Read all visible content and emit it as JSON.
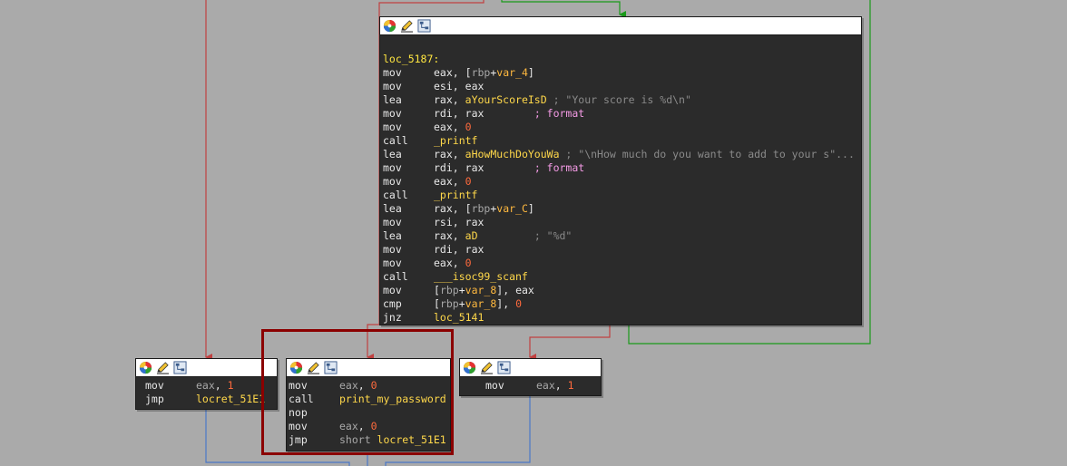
{
  "colors": {
    "background": "#aaaaaa",
    "block_bg": "#2b2b2b",
    "edge_red": "#c04040",
    "edge_green": "#1a9a1a",
    "edge_blue": "#4a78c8",
    "selection": "#8b0000"
  },
  "icons": [
    "graph-color-icon",
    "rename-pencil-icon",
    "graph-overview-icon"
  ],
  "main_block": {
    "label": "loc_5187:",
    "lines": [
      {
        "mn": "mov",
        "ops": [
          [
            "eax",
            "n"
          ],
          [
            ", [",
            "n"
          ],
          [
            "rbp",
            "reg"
          ],
          [
            "+",
            "n"
          ],
          [
            "var_4",
            "var"
          ],
          [
            "]",
            "n"
          ]
        ]
      },
      {
        "mn": "mov",
        "ops": [
          [
            "esi",
            "n"
          ],
          [
            ", ",
            "n"
          ],
          [
            "eax",
            "n"
          ]
        ]
      },
      {
        "mn": "lea",
        "ops": [
          [
            "rax",
            "n"
          ],
          [
            ", ",
            "n"
          ],
          [
            "aYourScoreIsD",
            "name"
          ],
          [
            " ; \"Your score is %d\\n\"",
            "cmt"
          ]
        ]
      },
      {
        "mn": "mov",
        "ops": [
          [
            "rdi",
            "n"
          ],
          [
            ", ",
            "n"
          ],
          [
            "rax",
            "n"
          ],
          [
            "        ",
            "n"
          ],
          [
            "; format",
            "fmt"
          ]
        ]
      },
      {
        "mn": "mov",
        "ops": [
          [
            "eax",
            "n"
          ],
          [
            ", ",
            "n"
          ],
          [
            "0",
            "num"
          ]
        ]
      },
      {
        "mn": "call",
        "ops": [
          [
            "_printf",
            "name"
          ]
        ]
      },
      {
        "mn": "lea",
        "ops": [
          [
            "rax",
            "n"
          ],
          [
            ", ",
            "n"
          ],
          [
            "aHowMuchDoYouWa",
            "name"
          ],
          [
            " ; \"\\nHow much do you want to add to your s\"...",
            "cmt"
          ]
        ]
      },
      {
        "mn": "mov",
        "ops": [
          [
            "rdi",
            "n"
          ],
          [
            ", ",
            "n"
          ],
          [
            "rax",
            "n"
          ],
          [
            "        ",
            "n"
          ],
          [
            "; format",
            "fmt"
          ]
        ]
      },
      {
        "mn": "mov",
        "ops": [
          [
            "eax",
            "n"
          ],
          [
            ", ",
            "n"
          ],
          [
            "0",
            "num"
          ]
        ]
      },
      {
        "mn": "call",
        "ops": [
          [
            "_printf",
            "name"
          ]
        ]
      },
      {
        "mn": "lea",
        "ops": [
          [
            "rax",
            "n"
          ],
          [
            ", [",
            "n"
          ],
          [
            "rbp",
            "reg"
          ],
          [
            "+",
            "n"
          ],
          [
            "var_C",
            "var"
          ],
          [
            "]",
            "n"
          ]
        ]
      },
      {
        "mn": "mov",
        "ops": [
          [
            "rsi",
            "n"
          ],
          [
            ", ",
            "n"
          ],
          [
            "rax",
            "n"
          ]
        ]
      },
      {
        "mn": "lea",
        "ops": [
          [
            "rax",
            "n"
          ],
          [
            ", ",
            "n"
          ],
          [
            "aD",
            "name"
          ],
          [
            "         ",
            "n"
          ],
          [
            "; \"%d\"",
            "cmt"
          ]
        ]
      },
      {
        "mn": "mov",
        "ops": [
          [
            "rdi",
            "n"
          ],
          [
            ", ",
            "n"
          ],
          [
            "rax",
            "n"
          ]
        ]
      },
      {
        "mn": "mov",
        "ops": [
          [
            "eax",
            "n"
          ],
          [
            ", ",
            "n"
          ],
          [
            "0",
            "num"
          ]
        ]
      },
      {
        "mn": "call",
        "ops": [
          [
            "___isoc99_scanf",
            "name"
          ]
        ]
      },
      {
        "mn": "mov",
        "ops": [
          [
            "[",
            "n"
          ],
          [
            "rbp",
            "reg"
          ],
          [
            "+",
            "n"
          ],
          [
            "var_8",
            "var"
          ],
          [
            "], ",
            "n"
          ],
          [
            "eax",
            "n"
          ]
        ]
      },
      {
        "mn": "cmp",
        "ops": [
          [
            "[",
            "n"
          ],
          [
            "rbp",
            "reg"
          ],
          [
            "+",
            "n"
          ],
          [
            "var_8",
            "var"
          ],
          [
            "], ",
            "n"
          ],
          [
            "0",
            "num"
          ]
        ]
      },
      {
        "mn": "jnz",
        "ops": [
          [
            "loc_5141",
            "name"
          ]
        ]
      }
    ]
  },
  "left_block": {
    "lines": [
      {
        "mn": "mov",
        "ops": [
          [
            "eax",
            "reg"
          ],
          [
            ", ",
            "n"
          ],
          [
            "1",
            "num"
          ]
        ]
      },
      {
        "mn": "jmp",
        "ops": [
          [
            "locret_51E1",
            "name"
          ]
        ]
      }
    ]
  },
  "middle_block": {
    "lines": [
      {
        "mn": "mov",
        "ops": [
          [
            "eax",
            "reg"
          ],
          [
            ", ",
            "n"
          ],
          [
            "0",
            "num"
          ]
        ]
      },
      {
        "mn": "call",
        "ops": [
          [
            "print_my_password",
            "name"
          ]
        ]
      },
      {
        "mn": "nop",
        "ops": []
      },
      {
        "mn": "mov",
        "ops": [
          [
            "eax",
            "reg"
          ],
          [
            ", ",
            "n"
          ],
          [
            "0",
            "num"
          ]
        ]
      },
      {
        "mn": "jmp",
        "ops": [
          [
            "short ",
            "reg"
          ],
          [
            "locret_51E1",
            "name"
          ]
        ]
      }
    ]
  },
  "right_block": {
    "lines": [
      {
        "mn": "mov",
        "ops": [
          [
            "eax",
            "reg"
          ],
          [
            ", ",
            "n"
          ],
          [
            "1",
            "num"
          ]
        ]
      }
    ]
  }
}
